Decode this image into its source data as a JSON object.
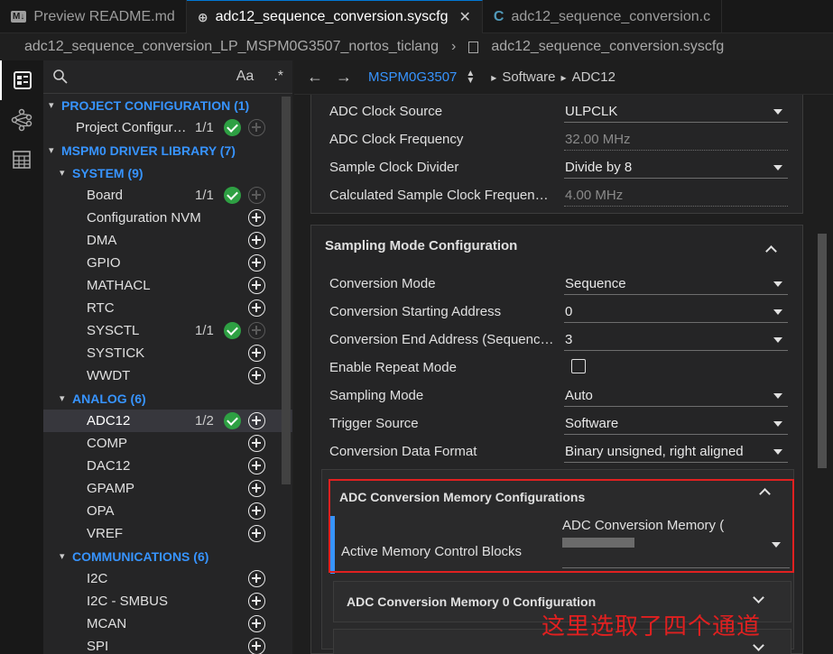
{
  "tabs": [
    {
      "label": "Preview README.md",
      "icon": "markdown-icon",
      "active": false
    },
    {
      "label": "adc12_sequence_conversion.syscfg",
      "icon": "globe-icon",
      "active": true
    },
    {
      "label": "adc12_sequence_conversion.c",
      "icon": "c-file-icon",
      "active": false
    }
  ],
  "breadcrumb": {
    "project": "adc12_sequence_conversion_LP_MSPM0G3507_nortos_ticlang",
    "file": "adc12_sequence_conversion.syscfg"
  },
  "tree": {
    "search_case_label": "Aa",
    "rows": [
      {
        "type": "cat",
        "chev": "▾",
        "label": "PROJECT CONFIGURATION (1)",
        "indent": 6
      },
      {
        "type": "item",
        "label": "Project Configur…",
        "count": "1/1",
        "check": true,
        "plus": "dim",
        "indent": 36
      },
      {
        "type": "cat",
        "chev": "▾",
        "label": "MSPM0 DRIVER LIBRARY (7)",
        "indent": 6
      },
      {
        "type": "cat",
        "chev": "▾",
        "label": "SYSTEM (9)",
        "indent": 18
      },
      {
        "type": "item",
        "label": "Board",
        "count": "1/1",
        "check": true,
        "plus": "dim",
        "indent": 48
      },
      {
        "type": "item",
        "label": "Configuration NVM",
        "plus": "on",
        "indent": 48
      },
      {
        "type": "item",
        "label": "DMA",
        "plus": "on",
        "indent": 48
      },
      {
        "type": "item",
        "label": "GPIO",
        "plus": "on",
        "indent": 48
      },
      {
        "type": "item",
        "label": "MATHACL",
        "plus": "on",
        "indent": 48
      },
      {
        "type": "item",
        "label": "RTC",
        "plus": "on",
        "indent": 48
      },
      {
        "type": "item",
        "label": "SYSCTL",
        "count": "1/1",
        "check": true,
        "plus": "dim",
        "indent": 48
      },
      {
        "type": "item",
        "label": "SYSTICK",
        "plus": "on",
        "indent": 48
      },
      {
        "type": "item",
        "label": "WWDT",
        "plus": "on",
        "indent": 48
      },
      {
        "type": "cat",
        "chev": "▾",
        "label": "ANALOG (6)",
        "indent": 18
      },
      {
        "type": "item",
        "label": "ADC12",
        "count": "1/2",
        "check": true,
        "plus": "on",
        "indent": 48,
        "selected": true
      },
      {
        "type": "item",
        "label": "COMP",
        "plus": "on",
        "indent": 48
      },
      {
        "type": "item",
        "label": "DAC12",
        "plus": "on",
        "indent": 48
      },
      {
        "type": "item",
        "label": "GPAMP",
        "plus": "on",
        "indent": 48
      },
      {
        "type": "item",
        "label": "OPA",
        "plus": "on",
        "indent": 48
      },
      {
        "type": "item",
        "label": "VREF",
        "plus": "on",
        "indent": 48
      },
      {
        "type": "cat",
        "chev": "▾",
        "label": "COMMUNICATIONS (6)",
        "indent": 18
      },
      {
        "type": "item",
        "label": "I2C",
        "plus": "on",
        "indent": 48
      },
      {
        "type": "item",
        "label": "I2C - SMBUS",
        "plus": "on",
        "indent": 48
      },
      {
        "type": "item",
        "label": "MCAN",
        "plus": "on",
        "indent": 48
      },
      {
        "type": "item",
        "label": "SPI",
        "plus": "on",
        "indent": 48
      }
    ]
  },
  "nav": {
    "device": "MSPM0G3507",
    "path": [
      "Software",
      "ADC12"
    ]
  },
  "clock": {
    "rows": [
      {
        "label": "ADC Clock Source",
        "value": "ULPCLK",
        "kind": "select"
      },
      {
        "label": "ADC Clock Frequency",
        "value": "32.00 MHz",
        "kind": "readonly"
      },
      {
        "label": "Sample Clock Divider",
        "value": "Divide by 8",
        "kind": "select"
      },
      {
        "label": "Calculated Sample Clock Frequen…",
        "value": "4.00 MHz",
        "kind": "readonly"
      }
    ]
  },
  "sampling": {
    "title": "Sampling Mode Configuration",
    "rows": [
      {
        "label": "Conversion Mode",
        "value": "Sequence",
        "kind": "select"
      },
      {
        "label": "Conversion Starting Address",
        "value": "0",
        "kind": "select"
      },
      {
        "label": "Conversion End Address (Sequenc…",
        "value": "3",
        "kind": "select"
      },
      {
        "label": "Enable Repeat Mode",
        "value": "",
        "kind": "checkbox"
      },
      {
        "label": "Sampling Mode",
        "value": "Auto",
        "kind": "select"
      },
      {
        "label": "Trigger Source",
        "value": "Software",
        "kind": "select"
      },
      {
        "label": "Conversion Data Format",
        "value": "Binary unsigned, right aligned",
        "kind": "select"
      }
    ]
  },
  "memory": {
    "title": "ADC Conversion Memory Configurations",
    "active_label": "Active Memory Control Blocks",
    "active_value": "ADC Conversion Memory (",
    "sub0_title": "ADC Conversion Memory 0 Configuration"
  },
  "annotation": "这里选取了四个通道",
  "colors": {
    "accent": "#3794ff",
    "check": "#2ea043",
    "highlight": "#e02020"
  }
}
